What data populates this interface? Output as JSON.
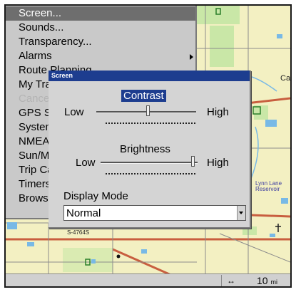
{
  "menu": {
    "items": [
      {
        "label": "Screen...",
        "state": "selected"
      },
      {
        "label": "Sounds...",
        "state": "normal"
      },
      {
        "label": "Transparency...",
        "state": "normal"
      },
      {
        "label": "Alarms",
        "state": "normal",
        "submenu": true
      },
      {
        "label": "Route Planning...",
        "state": "normal"
      },
      {
        "label": "My Trails...",
        "state": "normal"
      },
      {
        "label": "Cancel Navigation",
        "state": "disabled"
      },
      {
        "label": "GPS Setup",
        "state": "normal"
      },
      {
        "label": "System Setup",
        "state": "normal"
      },
      {
        "label": "NMEA 2000...",
        "state": "normal"
      },
      {
        "label": "Sun/Moon Calc...",
        "state": "normal"
      },
      {
        "label": "Trip Calculator...",
        "state": "normal"
      },
      {
        "label": "Timers",
        "state": "normal"
      },
      {
        "label": "Browse MMC Files",
        "state": "normal"
      }
    ]
  },
  "dialog": {
    "title": "Screen",
    "contrast": {
      "label": "Contrast",
      "low": "Low",
      "high": "High",
      "level": 0.52
    },
    "brightness": {
      "label": "Brightness",
      "low": "Low",
      "high": "High",
      "level": 0.97
    },
    "display_mode": {
      "label": "Display Mode",
      "value": "Normal"
    }
  },
  "map": {
    "labels": {
      "lake_line1": "Lynn Lane",
      "lake_line2": "Reservoir",
      "road": "S-4764S",
      "edge": "Ca"
    }
  },
  "status_bar": {
    "scale_icon": "double-arrow-icon",
    "scale_value": "10",
    "scale_unit": "mi"
  },
  "colors": {
    "land": "#f3f0c2",
    "park": "#c9e7a7",
    "water": "#78b9e6",
    "major_road": "#c85e3f",
    "title_bar": "#1d3d8f"
  }
}
